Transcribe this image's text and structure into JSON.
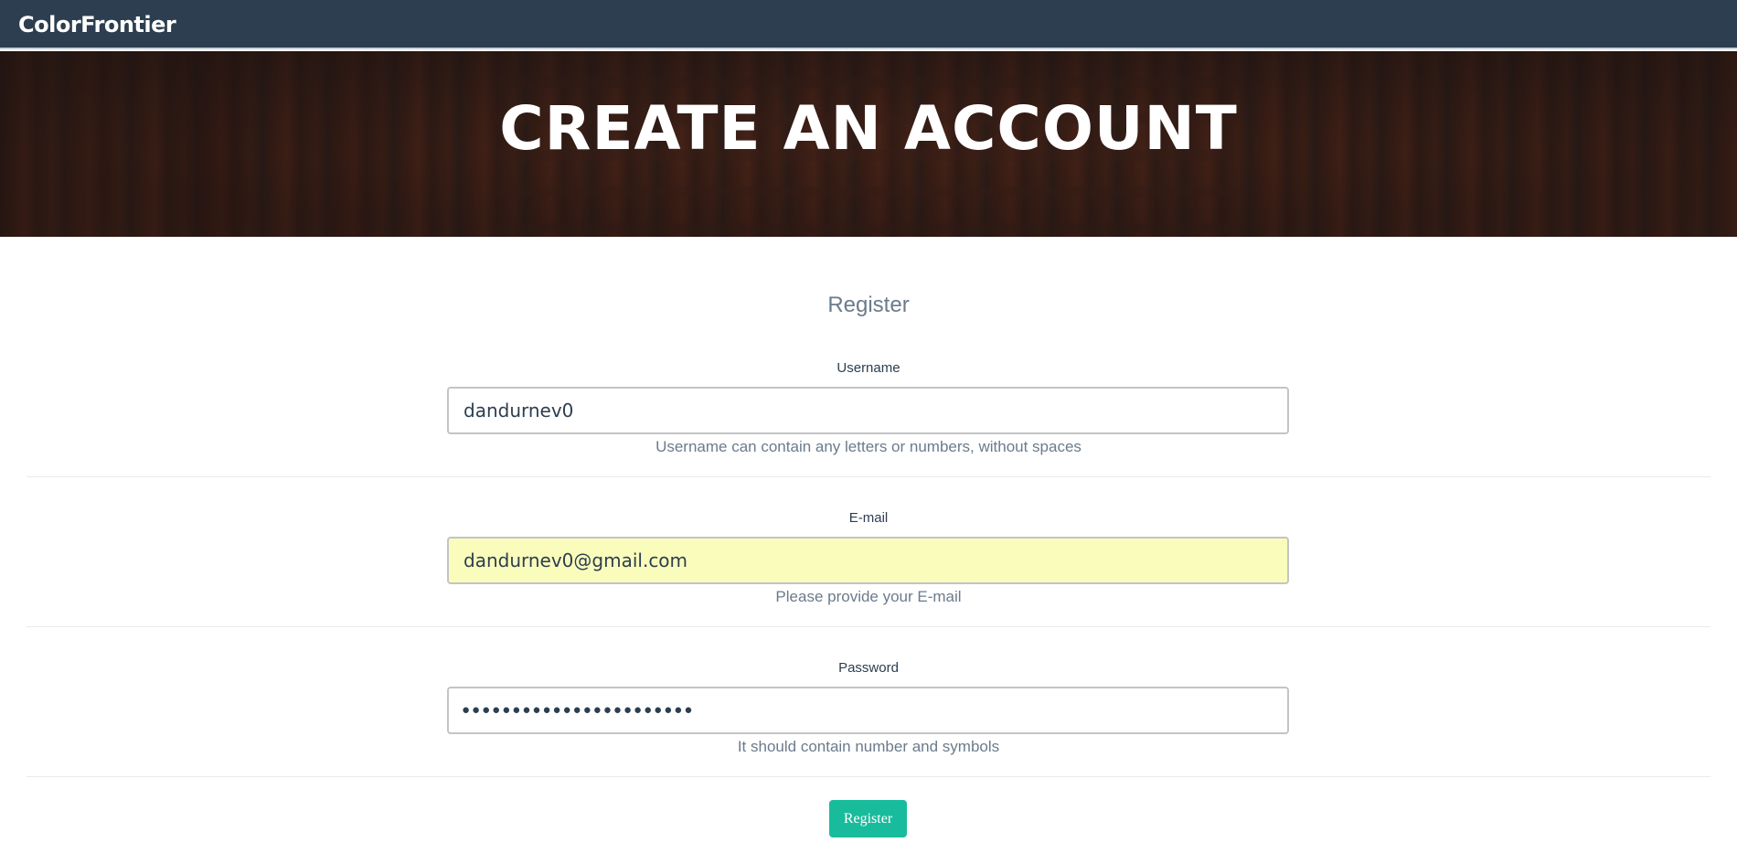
{
  "navbar": {
    "brand": "ColorFrontier"
  },
  "hero": {
    "title": "CREATE AN ACCOUNT"
  },
  "form": {
    "title": "Register",
    "username": {
      "label": "Username",
      "value": "dandurnev0",
      "help": "Username can contain any letters or numbers, without spaces"
    },
    "email": {
      "label": "E-mail",
      "value": "dandurnev0@gmail.com",
      "help": "Please provide your E-mail"
    },
    "password": {
      "label": "Password",
      "masked_value": "●●●●●●●●●●●●●●●●●●●●●●●",
      "help": "It should contain number and symbols"
    },
    "submit_label": "Register"
  },
  "colors": {
    "navbar": "#2c3e50",
    "button": "#18bc9c",
    "autofill": "#fafcbb"
  }
}
